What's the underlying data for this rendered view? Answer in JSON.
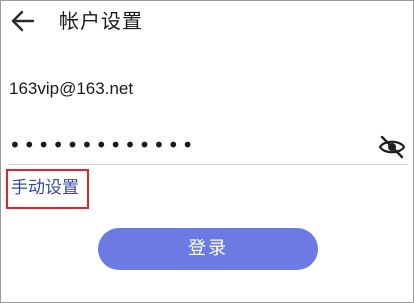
{
  "header": {
    "title": "帐户设置",
    "back_icon": "arrow-left-icon"
  },
  "form": {
    "email_value": "163vip@163.net",
    "password_masked": "•••••••••••••",
    "password_toggle_icon": "eye-off-icon",
    "manual_setup_label": "手动设置",
    "login_label": "登录"
  },
  "colors": {
    "login_button": "#6b7be3",
    "link": "#3949a3",
    "highlight_border": "#e0242c"
  }
}
